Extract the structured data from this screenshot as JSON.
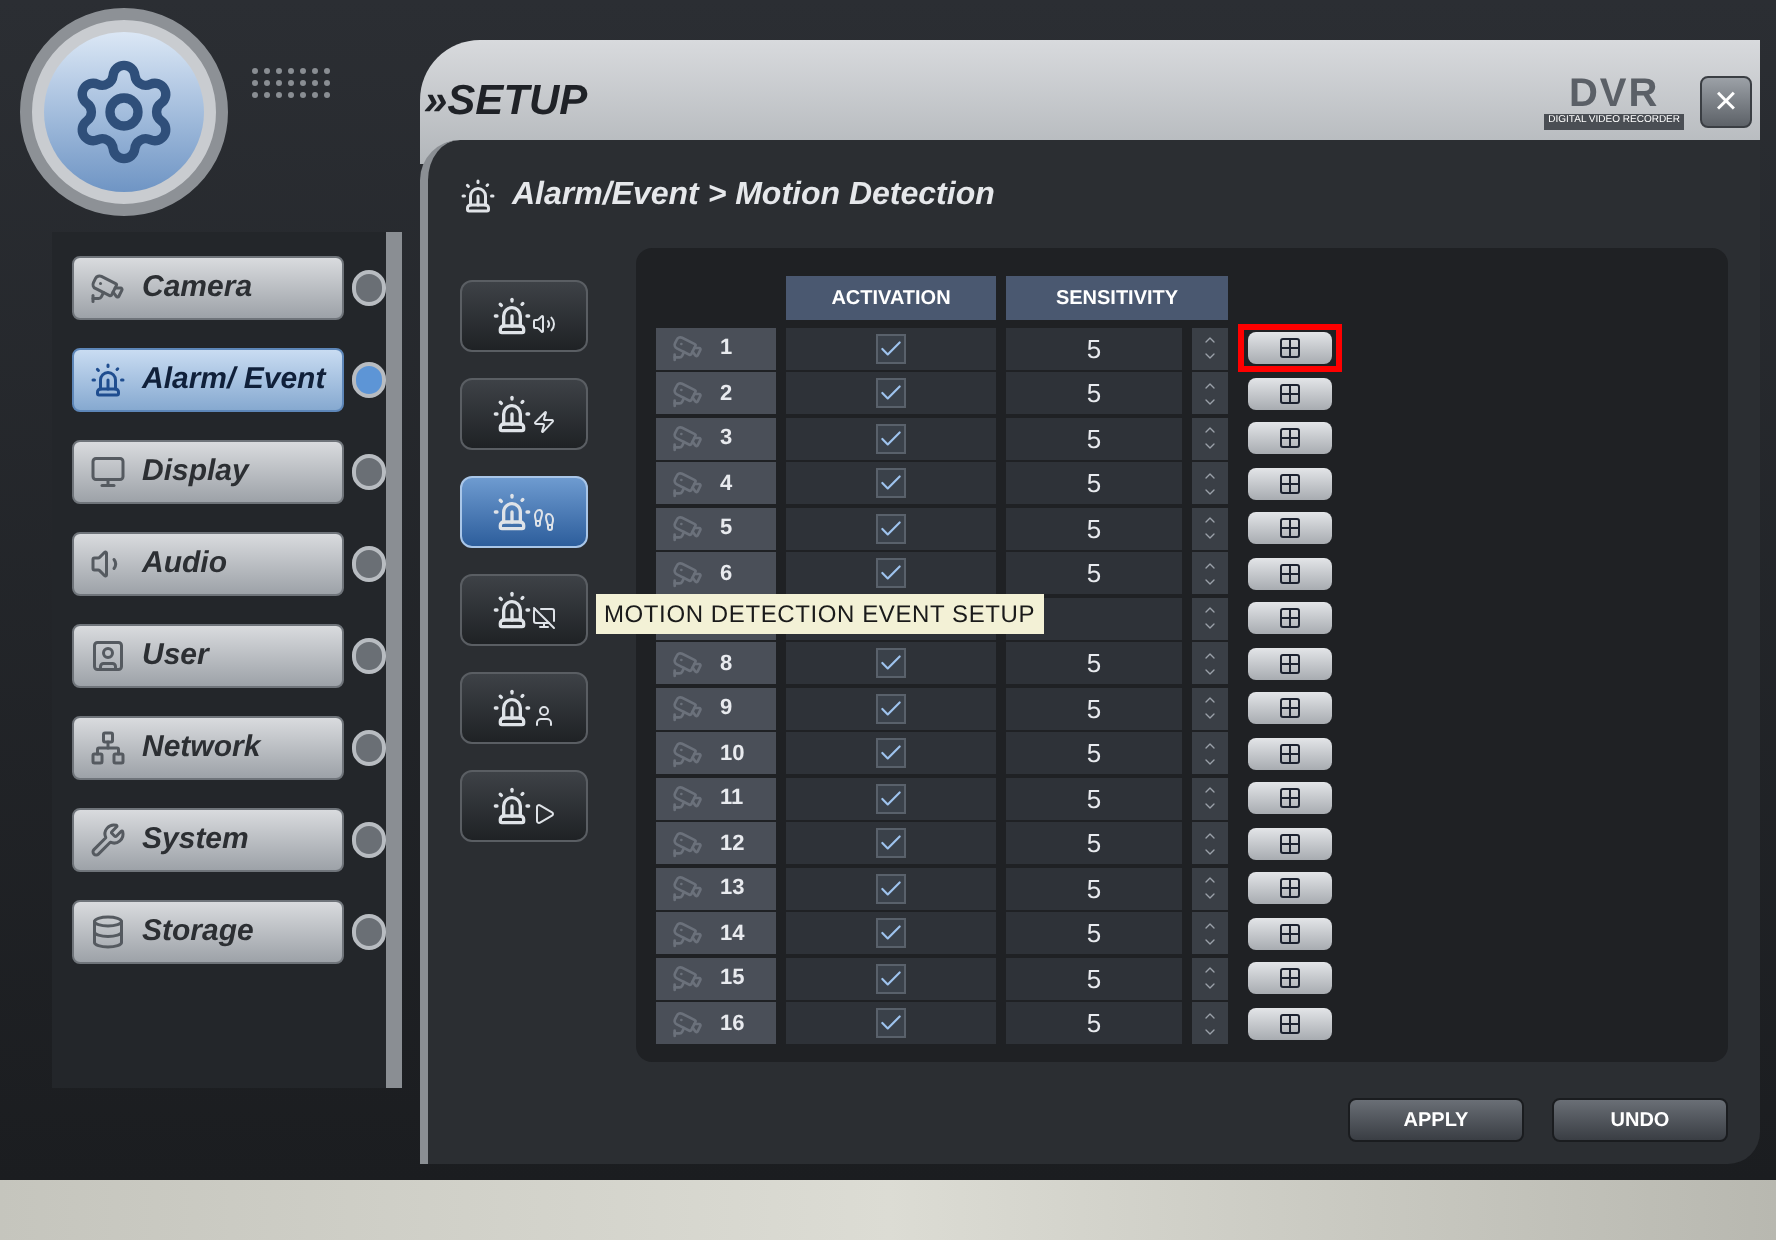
{
  "header": {
    "title": "»SETUP",
    "logo_text": "DVR",
    "logo_subtext": "DIGITAL VIDEO RECORDER",
    "close": "×"
  },
  "sidebar": {
    "items": [
      {
        "label": "Camera",
        "kind": "camera",
        "selected": false
      },
      {
        "label": "Alarm/ Event",
        "kind": "alarm",
        "selected": true
      },
      {
        "label": "Display",
        "kind": "display",
        "selected": false
      },
      {
        "label": "Audio",
        "kind": "audio",
        "selected": false
      },
      {
        "label": "User",
        "kind": "user",
        "selected": false
      },
      {
        "label": "Network",
        "kind": "network",
        "selected": false
      },
      {
        "label": "System",
        "kind": "system",
        "selected": false
      },
      {
        "label": "Storage",
        "kind": "storage",
        "selected": false
      }
    ]
  },
  "breadcrumb": "Alarm/Event > Motion Detection",
  "sub_buttons": [
    {
      "kind": "sound",
      "selected": false
    },
    {
      "kind": "sensor",
      "selected": false
    },
    {
      "kind": "motion",
      "selected": true
    },
    {
      "kind": "video-loss",
      "selected": false
    },
    {
      "kind": "user",
      "selected": false
    },
    {
      "kind": "record",
      "selected": false
    }
  ],
  "tooltip": "MOTION DETECTION EVENT SETUP",
  "table": {
    "columns": [
      "ACTIVATION",
      "SENSITIVITY"
    ],
    "rows": [
      {
        "number": "1",
        "checked": true,
        "sensitivity": "5",
        "highlighted": true
      },
      {
        "number": "2",
        "checked": true,
        "sensitivity": "5",
        "highlighted": false
      },
      {
        "number": "3",
        "checked": true,
        "sensitivity": "5",
        "highlighted": false
      },
      {
        "number": "4",
        "checked": true,
        "sensitivity": "5",
        "highlighted": false
      },
      {
        "number": "5",
        "checked": true,
        "sensitivity": "5",
        "highlighted": false
      },
      {
        "number": "6",
        "checked": true,
        "sensitivity": "5",
        "highlighted": false
      },
      {
        "highlighted": false
      },
      {
        "number": "8",
        "checked": true,
        "sensitivity": "5",
        "highlighted": false
      },
      {
        "number": "9",
        "checked": true,
        "sensitivity": "5",
        "highlighted": false
      },
      {
        "number": "10",
        "checked": true,
        "sensitivity": "5",
        "highlighted": false
      },
      {
        "number": "11",
        "checked": true,
        "sensitivity": "5",
        "highlighted": false
      },
      {
        "number": "12",
        "checked": true,
        "sensitivity": "5",
        "highlighted": false
      },
      {
        "number": "13",
        "checked": true,
        "sensitivity": "5",
        "highlighted": false
      },
      {
        "number": "14",
        "checked": true,
        "sensitivity": "5",
        "highlighted": false
      },
      {
        "number": "15",
        "checked": true,
        "sensitivity": "5",
        "highlighted": false
      },
      {
        "number": "16",
        "checked": true,
        "sensitivity": "5",
        "highlighted": false
      }
    ]
  },
  "buttons": [
    "APPLY",
    "UNDO"
  ]
}
